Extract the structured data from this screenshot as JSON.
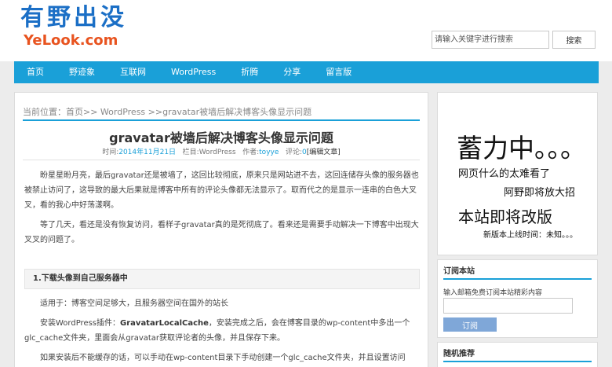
{
  "header": {
    "logo_cn": "有野出没",
    "logo_en": "YeLook.com",
    "search_placeholder": "请输入关键字进行搜索",
    "search_button": "搜索"
  },
  "nav": {
    "items": [
      "首页",
      "野迹象",
      "互联网",
      "WordPress",
      "折腾",
      "分享",
      "留言版"
    ]
  },
  "article": {
    "breadcrumb": "当前位置：首页>> WordPress >>gravatar被墙后解决博客头像显示问题",
    "title": "gravatar被墙后解决博客头像显示问题",
    "meta": {
      "time_label": "时间:",
      "time_value": "2014年11月21日",
      "category_label": "栏目:",
      "category_value": "WordPress",
      "author_label": "作者:",
      "author_value": "toyye",
      "comments_label": "评论:",
      "comments_value": "0",
      "edit_label": "[编辑文章]"
    },
    "paragraph1": "盼星星盼月亮，最后gravatar还是被墙了，这回比较彻底，原来只是网站进不去，这回连储存头像的服务器也被禁止访问了，这导致的最大后果就是博客中所有的评论头像都无法显示了。取而代之的是显示一连串的白色大叉叉，看的我心中好荡漾啊。",
    "paragraph2": "等了几天，看还是没有恢复访问，看样子gravatar真的是死彻底了。看来还是需要手动解决一下博客中出现大叉叉的问题了。",
    "section1_title": "1.下载头像到自己服务器中",
    "paragraph3": "适用于：博客空间足够大，且服务器空间在国外的站长",
    "paragraph4_before": "安装WordPress插件：",
    "paragraph4_bold": "GravatarLocalCache",
    "paragraph4_after": "，安装完成之后，会在博客目录的wp-content中多出一个glc_cache文件夹，里面会从gravatar获取评论者的头像，并且保存下来。",
    "paragraph5": "如果安装后不能缓存的话，可以手动在wp-content目录下手动创建一个glc_cache文件夹，并且设置访问"
  },
  "sidebar": {
    "ad": {
      "line1": "蓄力中。。。",
      "line2": "网页什么的太难看了",
      "line3": "阿野即将放大招",
      "line4": "本站即将改版",
      "line5": "新版本上线时间：未知。。。"
    },
    "subscribe": {
      "title": "订阅本站",
      "description": "输入邮箱免费订阅本站精彩内容",
      "button": "订阅"
    },
    "random": {
      "title": "随机推荐"
    }
  }
}
